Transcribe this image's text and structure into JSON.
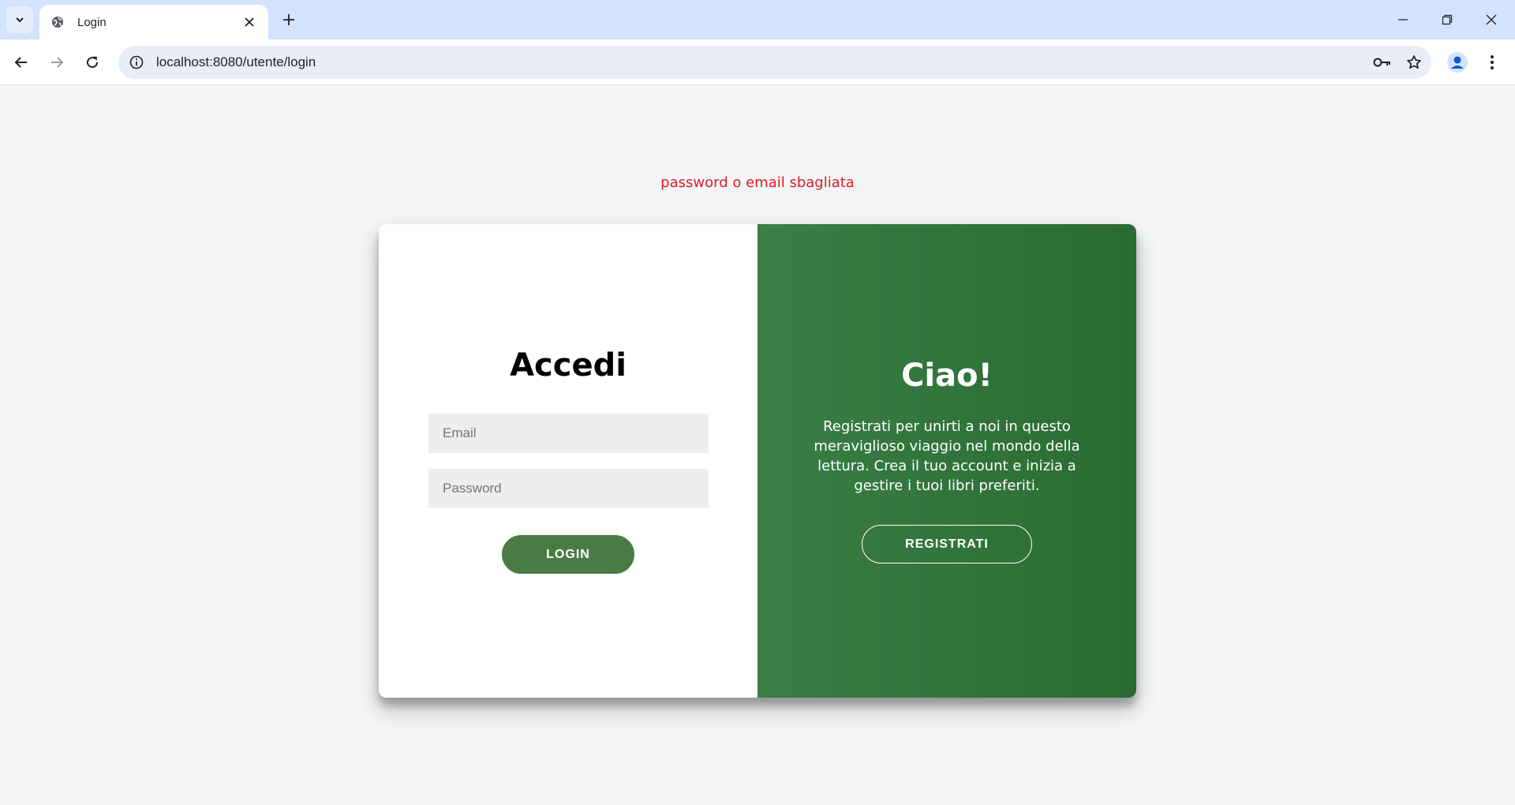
{
  "browser": {
    "tab_title": "Login",
    "url": "localhost:8080/utente/login"
  },
  "page": {
    "error_message": "password o email sbagliata",
    "login": {
      "title": "Accedi",
      "email_placeholder": "Email",
      "password_placeholder": "Password",
      "button_label": "LOGIN"
    },
    "register_panel": {
      "title": "Ciao!",
      "text": "Registrati per unirti a noi in questo meraviglioso viaggio nel mondo della lettura. Crea il tuo account e inizia a gestire i tuoi libri preferiti.",
      "button_label": "REGISTRATI"
    }
  },
  "colors": {
    "error": "#e01b24",
    "panel_green_start": "#3a7f47",
    "panel_green_end": "#2a6b30",
    "login_button": "#4b7b45"
  }
}
